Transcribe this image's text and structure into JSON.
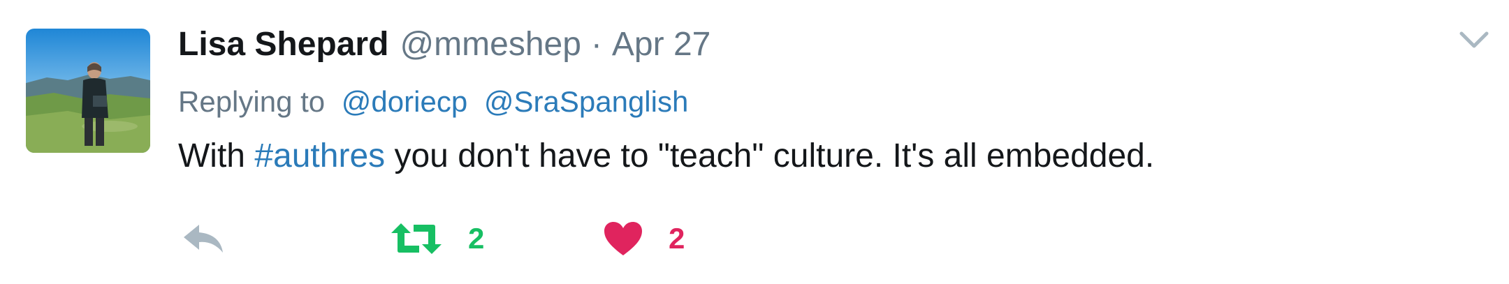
{
  "tweet": {
    "display_name": "Lisa Shepard",
    "handle": "@mmeshep",
    "separator": "·",
    "date": "Apr 27",
    "reply": {
      "prefix": "Replying to",
      "mentions": [
        "@doriecp",
        "@SraSpanglish"
      ]
    },
    "text": {
      "before": "With ",
      "hashtag": "#authres",
      "after": " you don't have to \"teach\" culture. It's all embedded."
    }
  },
  "actions": {
    "reply_icon": "reply-icon",
    "retweet_icon": "retweet-icon",
    "retweet_count": "2",
    "like_icon": "heart-icon",
    "like_count": "2"
  },
  "menu_icon": "chevron-down-icon",
  "colors": {
    "name": "#14171a",
    "secondary": "#657786",
    "link": "#2b7bb9",
    "reply_icon": "#aab8c2",
    "retweet": "#17bf63",
    "like": "#e0245e"
  }
}
